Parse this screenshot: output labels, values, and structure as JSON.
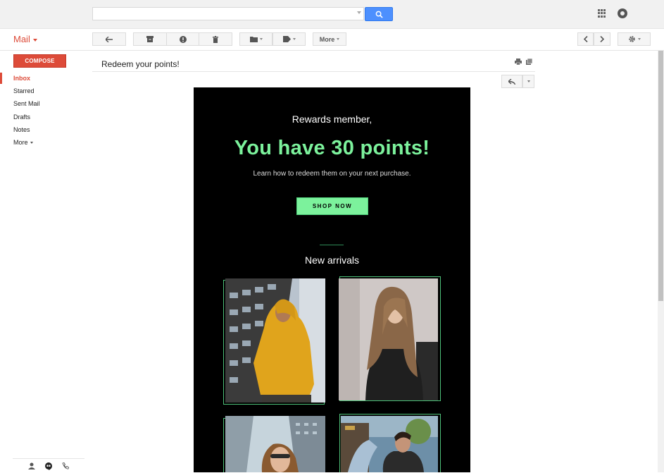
{
  "header": {
    "search": {
      "placeholder": ""
    }
  },
  "toolbar": {
    "mail_label": "Mail",
    "more_label": "More"
  },
  "sidebar": {
    "compose_label": "COMPOSE",
    "items": [
      {
        "label": "Inbox"
      },
      {
        "label": "Starred"
      },
      {
        "label": "Sent Mail"
      },
      {
        "label": "Drafts"
      },
      {
        "label": "Notes"
      },
      {
        "label": "More"
      }
    ]
  },
  "message": {
    "subject": "Redeem your points!"
  },
  "email": {
    "greeting": "Rewards member,",
    "headline": "You have 30 points!",
    "subline": "Learn how to redeem them on your next purchase.",
    "cta_label": "SHOP NOW",
    "section_title": "New arrivals"
  },
  "colors": {
    "gmail_red": "#dd4b39",
    "search_blue": "#4d90fe",
    "email_bg": "#000000",
    "accent_green": "#7cf29c"
  },
  "icons": {
    "search": "search-icon",
    "apps": "apps-grid-icon",
    "account": "account-icon",
    "back": "back-arrow-icon",
    "archive": "archive-icon",
    "spam": "report-spam-icon",
    "delete": "trash-icon",
    "move": "folder-icon",
    "labels": "label-icon",
    "prev": "chevron-left-icon",
    "next": "chevron-right-icon",
    "settings": "gear-icon",
    "print": "print-icon",
    "new_window": "new-window-icon",
    "reply": "reply-icon",
    "contacts": "person-icon",
    "hangouts": "hangouts-icon",
    "phone": "phone-icon"
  }
}
